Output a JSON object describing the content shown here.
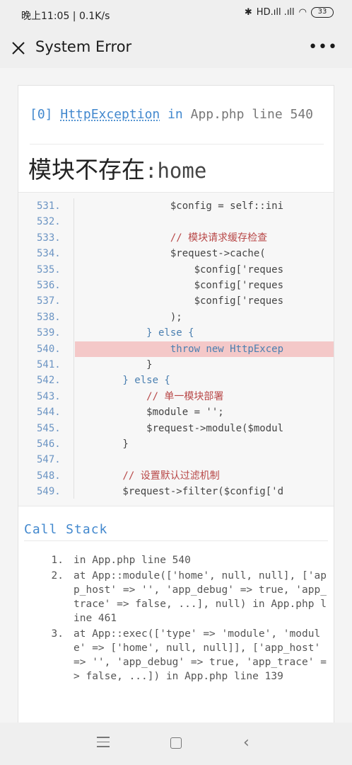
{
  "status_bar": {
    "time_and_speed": "晚上11:05 | 0.1K/s",
    "bluetooth": "✱",
    "signal": "HD.ıll .ıll",
    "wifi": "◠",
    "battery": "33"
  },
  "appbar": {
    "title": "System Error",
    "more": "•••"
  },
  "exception": {
    "code": "[0]",
    "class_name": "HttpException",
    "in_word": "in",
    "file": "App.php",
    "line_label": "line 540",
    "message_cn": "模块不存在",
    "message_sep": ":",
    "message_module": "home"
  },
  "source": {
    "highlight_line": 540,
    "lines": [
      {
        "no": "531.",
        "text": "                $config = self::ini"
      },
      {
        "no": "532.",
        "text": ""
      },
      {
        "no": "533.",
        "text": "                // 模块请求缓存检查"
      },
      {
        "no": "534.",
        "text": "                $request->cache("
      },
      {
        "no": "535.",
        "text": "                    $config['reques"
      },
      {
        "no": "536.",
        "text": "                    $config['reques"
      },
      {
        "no": "537.",
        "text": "                    $config['reques"
      },
      {
        "no": "538.",
        "text": "                );"
      },
      {
        "no": "539.",
        "text": "            } else {"
      },
      {
        "no": "540.",
        "text": "                throw new HttpExcep"
      },
      {
        "no": "541.",
        "text": "            }"
      },
      {
        "no": "542.",
        "text": "        } else {"
      },
      {
        "no": "543.",
        "text": "            // 单一模块部署"
      },
      {
        "no": "544.",
        "text": "            $module = '';"
      },
      {
        "no": "545.",
        "text": "            $request->module($modul"
      },
      {
        "no": "546.",
        "text": "        }"
      },
      {
        "no": "547.",
        "text": ""
      },
      {
        "no": "548.",
        "text": "        // 设置默认过滤机制"
      },
      {
        "no": "549.",
        "text": "        $request->filter($config['d"
      }
    ]
  },
  "call_stack": {
    "title": "Call Stack",
    "frames": [
      {
        "num": "1.",
        "text": "in App.php line 540"
      },
      {
        "num": "2.",
        "text": "at App::module(['home', null, null], ['app_host' => '', 'app_debug' => true, 'app_trace' => false, ...], null) in App.php line 461"
      },
      {
        "num": "3.",
        "text": "at App::exec(['type' => 'module', 'module' => ['home', null, null]], ['app_host' => '', 'app_debug' => true, 'app_trace' => false, ...]) in App.php line 139"
      }
    ]
  },
  "navbar": {
    "menu": "menu-icon",
    "home": "home-icon",
    "back": "‹"
  }
}
